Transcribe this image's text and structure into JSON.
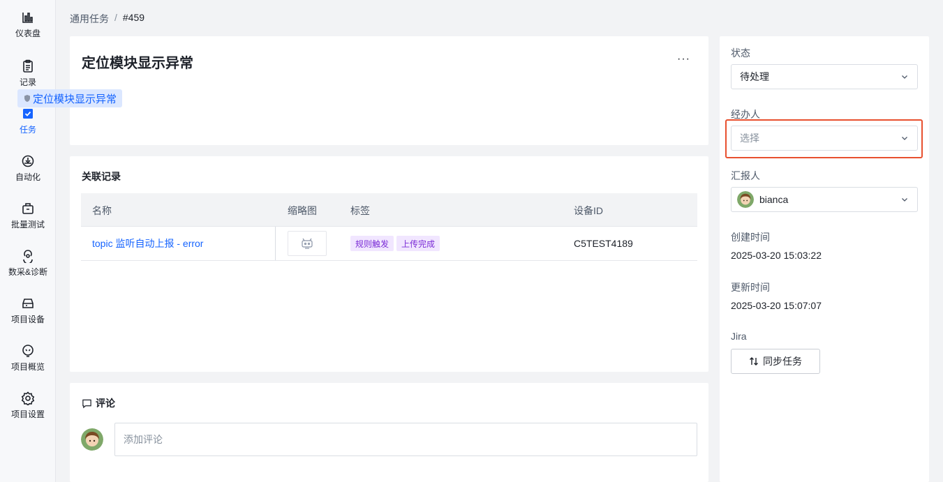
{
  "nav": [
    {
      "label": "仪表盘",
      "icon": "dashboard-icon"
    },
    {
      "label": "记录",
      "icon": "clipboard-icon"
    },
    {
      "label": "任务",
      "icon": "task-icon"
    },
    {
      "label": "自动化",
      "icon": "automation-icon"
    },
    {
      "label": "批量测试",
      "icon": "batch-test-icon"
    },
    {
      "label": "数采&诊断",
      "icon": "diagnosis-icon"
    },
    {
      "label": "项目设备",
      "icon": "device-icon"
    },
    {
      "label": "项目概览",
      "icon": "overview-icon"
    },
    {
      "label": "项目设置",
      "icon": "gear-icon"
    }
  ],
  "breadcrumb": {
    "parent": "通用任务",
    "separator": "/",
    "current": "#459"
  },
  "task": {
    "title": "定位模块显示异常",
    "more": "···",
    "tag": "定位模块显示异常"
  },
  "records": {
    "title": "关联记录",
    "columns": [
      "名称",
      "缩略图",
      "标签",
      "设备ID"
    ],
    "rows": [
      {
        "name": "topic 监听自动上报 - error",
        "tags": [
          "规则触发",
          "上传完成"
        ],
        "device_id": "C5TEST4189"
      }
    ]
  },
  "comments": {
    "title": "评论",
    "placeholder": "添加评论"
  },
  "side": {
    "status_label": "状态",
    "status_value": "待处理",
    "assignee_label": "经办人",
    "assignee_placeholder": "选择",
    "reporter_label": "汇报人",
    "reporter_value": "bianca",
    "created_label": "创建时间",
    "created_value": "2025-03-20 15:03:22",
    "updated_label": "更新时间",
    "updated_value": "2025-03-20 15:07:07",
    "jira_label": "Jira",
    "sync_button": "同步任务"
  },
  "colors": {
    "accent": "#1664ff",
    "highlight": "#e8502f",
    "tag_purple_bg": "#f1e6ff",
    "tag_purple_text": "#7b2cd6"
  }
}
